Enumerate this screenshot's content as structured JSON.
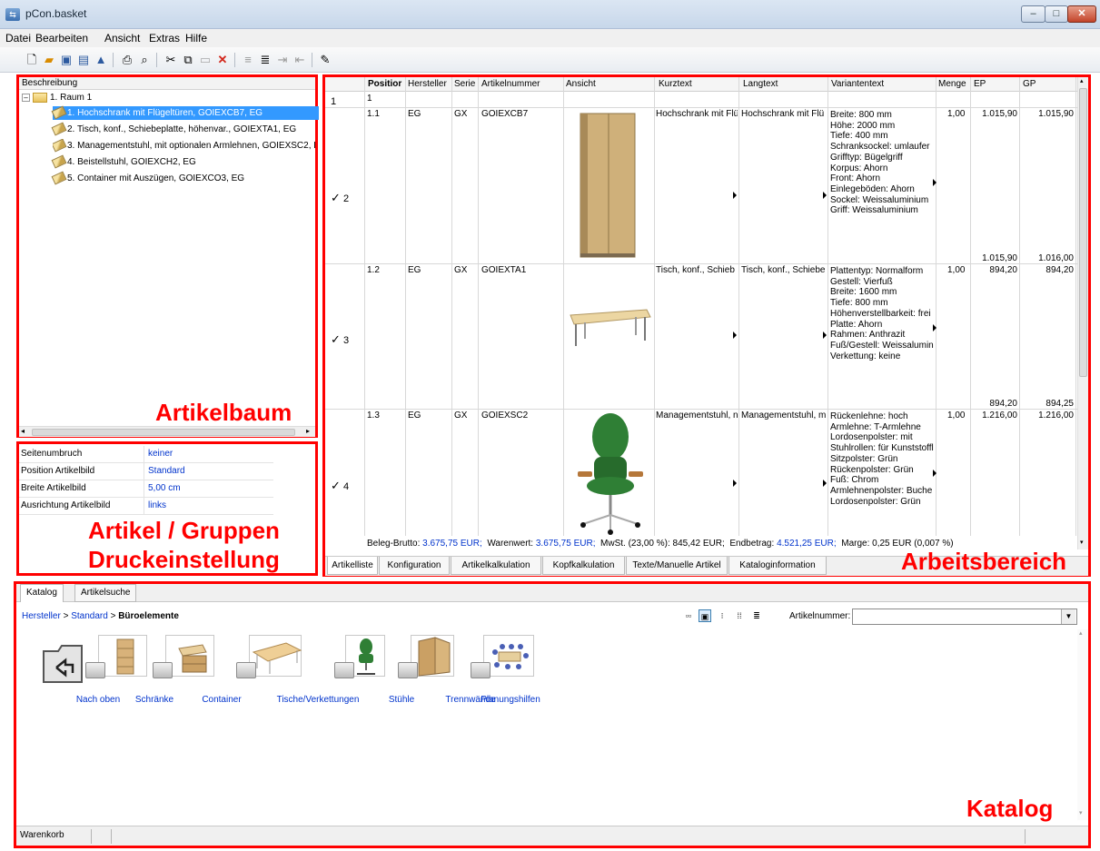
{
  "window": {
    "title": "pCon.basket"
  },
  "menu": [
    "Datei",
    "Bearbeiten",
    "Ansicht",
    "Extras",
    "Hilfe"
  ],
  "tree": {
    "header": "Beschreibung",
    "root": "1. Raum 1",
    "items": [
      "1. Hochschrank mit Flügeltüren, GOIEXCB7, EG",
      "2. Tisch, konf., Schiebeplatte, höhenvar., GOIEXTA1, EG",
      "3. Managementstuhl, mit optionalen Armlehnen, GOIEXSC2, E",
      "4. Beistellstuhl, GOIEXCH2, EG",
      "5. Container mit Auszügen, GOIEXCO3, EG"
    ],
    "label": "Artikelbaum"
  },
  "print_settings": {
    "rows": [
      {
        "key": "Seitenumbruch",
        "value": "keiner"
      },
      {
        "key": "Position Artikelbild",
        "value": "Standard"
      },
      {
        "key": "Breite Artikelbild",
        "value": "5,00 cm"
      },
      {
        "key": "Ausrichtung Artikelbild",
        "value": "links"
      }
    ],
    "label_line1": "Artikel / Gruppen",
    "label_line2": "Druckeinstellung"
  },
  "work": {
    "columns": [
      "Positior",
      "Hersteller",
      "Serie",
      "Artikelnummer",
      "Ansicht",
      "Kurztext",
      "Langtext",
      "Variantentext",
      "Menge",
      "EP",
      "GP"
    ],
    "group_row": {
      "rownum": "1",
      "position": "1"
    },
    "rows": [
      {
        "rownum": "2",
        "position": "1.1",
        "hersteller": "EG",
        "serie": "GX",
        "artnr": "GOIEXCB7",
        "kurztext": "Hochschrank mit Flü",
        "langtext": "Hochschrank mit Flü",
        "variant": [
          "Breite: 800 mm",
          "Höhe: 2000 mm",
          "Tiefe: 400 mm",
          "Schranksockel: umlaufer",
          "Grifftyp: Bügelgriff",
          "Korpus: Ahorn",
          "Front: Ahorn",
          "Einlegeböden: Ahorn",
          "Sockel: Weissaluminium",
          "Griff: Weissaluminium"
        ],
        "menge": "1,00",
        "ep": "1.015,90",
        "gp": "1.015,90",
        "ep2": "1.015,90",
        "gp2": "1.016,00"
      },
      {
        "rownum": "3",
        "position": "1.2",
        "hersteller": "EG",
        "serie": "GX",
        "artnr": "GOIEXTA1",
        "kurztext": "Tisch, konf., Schieb",
        "langtext": "Tisch, konf., Schiebe",
        "variant": [
          "Plattentyp: Normalform",
          "Gestell: Vierfuß",
          "Breite: 1600 mm",
          "Tiefe: 800 mm",
          "Höhenverstellbarkeit: frei",
          "Platte: Ahorn",
          "Rahmen: Anthrazit",
          "Fuß/Gestell: Weissalumin",
          "Verkettung: keine"
        ],
        "menge": "1,00",
        "ep": "894,20",
        "gp": "894,20",
        "ep2": "894,20",
        "gp2": "894,25"
      },
      {
        "rownum": "4",
        "position": "1.3",
        "hersteller": "EG",
        "serie": "GX",
        "artnr": "GOIEXSC2",
        "kurztext": "Managementstuhl, n",
        "langtext": "Managementstuhl, m",
        "variant": [
          "Rückenlehne: hoch",
          "Armlehne: T-Armlehne",
          "Lordosenpolster: mit",
          "Stuhlrollen: für Kunststoffl",
          "Sitzpolster: Grün",
          "Rückenpolster: Grün",
          "Fuß: Chrom",
          "Armlehnenpolster: Buche",
          "Lordosenpolster: Grün"
        ],
        "menge": "1,00",
        "ep": "1.216,00",
        "gp": "1.216,00"
      }
    ],
    "summary": {
      "brutto_label": "Beleg-Brutto:",
      "brutto": "3.675,75 EUR;",
      "waren_label": "Warenwert:",
      "waren": "3.675,75 EUR;",
      "mwst": "MwSt. (23,00 %): 845,42 EUR;",
      "end_label": "Endbetrag:",
      "end": "4.521,25 EUR;",
      "marge": "Marge: 0,25 EUR (0,007 %)"
    },
    "tabs": [
      "Artikelliste",
      "Konfiguration",
      "Artikelkalkulation",
      "Kopfkalkulation",
      "Texte/Manuelle Artikel",
      "Kataloginformation"
    ],
    "label": "Arbeitsbereich"
  },
  "catalog": {
    "tabs": [
      "Katalog",
      "Artikelsuche"
    ],
    "breadcrumb": {
      "a": "Hersteller",
      "sep": " > ",
      "b": "Standard",
      "current": "Büroelemente"
    },
    "artnr_label": "Artikelnummer:",
    "artnr_value": "",
    "items": [
      "Nach oben",
      "Schränke",
      "Container",
      "Tische/Verkettungen",
      "Stühle",
      "Trennwände",
      "Planungshilfen"
    ],
    "label": "Katalog",
    "status": "Warenkorb"
  },
  "colors": {
    "accent": "#3399ff",
    "annotation": "#ff0000",
    "link": "#0033cc"
  }
}
